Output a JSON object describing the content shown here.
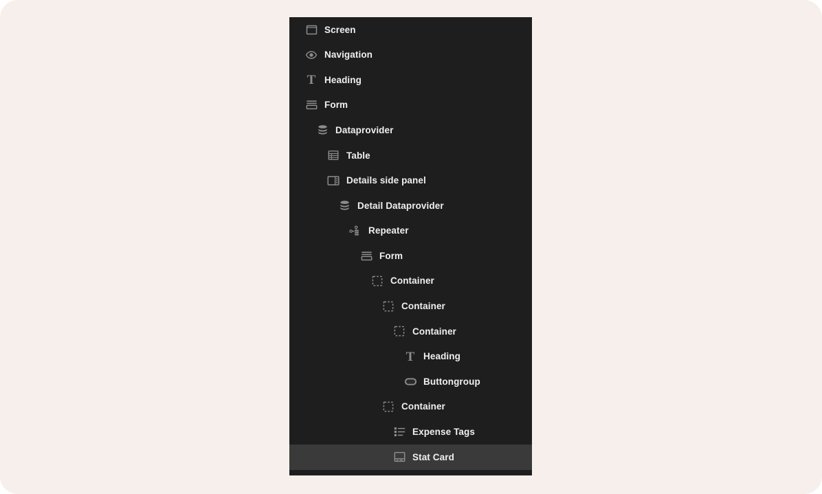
{
  "theme": {
    "page_background": "#f7efeb",
    "panel_background": "#1e1e1e",
    "selected_row_background": "#3a3a3a",
    "label_color": "#f0f0f0",
    "icon_color": "#8c8c8c"
  },
  "component_tree": {
    "name": "component-tree",
    "rows": [
      {
        "label": "Screen",
        "icon": "screen-icon",
        "depth": 0,
        "selected": false
      },
      {
        "label": "Navigation",
        "icon": "eye-icon",
        "depth": 0,
        "selected": false
      },
      {
        "label": "Heading",
        "icon": "text-heading-icon",
        "depth": 0,
        "selected": false
      },
      {
        "label": "Form",
        "icon": "form-icon",
        "depth": 0,
        "selected": false
      },
      {
        "label": "Dataprovider",
        "icon": "database-icon",
        "depth": 1,
        "selected": false
      },
      {
        "label": "Table",
        "icon": "table-icon",
        "depth": 2,
        "selected": false
      },
      {
        "label": "Details side panel",
        "icon": "side-panel-icon",
        "depth": 2,
        "selected": false
      },
      {
        "label": "Detail Dataprovider",
        "icon": "database-icon",
        "depth": 3,
        "selected": false
      },
      {
        "label": "Repeater",
        "icon": "repeater-icon",
        "depth": 4,
        "selected": false
      },
      {
        "label": "Form",
        "icon": "form-icon",
        "depth": 5,
        "selected": false
      },
      {
        "label": "Container",
        "icon": "container-icon",
        "depth": 6,
        "selected": false
      },
      {
        "label": "Container",
        "icon": "container-icon",
        "depth": 7,
        "selected": false
      },
      {
        "label": "Container",
        "icon": "container-icon",
        "depth": 8,
        "selected": false
      },
      {
        "label": "Heading",
        "icon": "text-heading-icon",
        "depth": 9,
        "selected": false
      },
      {
        "label": "Buttongroup",
        "icon": "buttongroup-icon",
        "depth": 9,
        "selected": false
      },
      {
        "label": "Container",
        "icon": "container-icon",
        "depth": 7,
        "selected": false
      },
      {
        "label": "Expense Tags",
        "icon": "list-icon",
        "depth": 8,
        "selected": false
      },
      {
        "label": "Stat Card",
        "icon": "stat-card-icon",
        "depth": 8,
        "selected": true
      }
    ]
  }
}
